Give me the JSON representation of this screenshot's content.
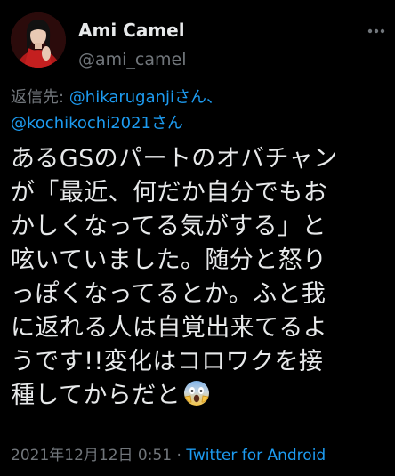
{
  "author": {
    "name": "Ami Camel",
    "handle": "@ami_camel"
  },
  "reply": {
    "prefix": "返信先: ",
    "mention1": "@hikaruganji",
    "suffix1": "さん、",
    "mention2": "@kochikochi2021",
    "suffix2": "さん"
  },
  "tweet": {
    "lines": [
      "あるGSのパートのオバチャン",
      "が「最近、何だか自分でもお",
      "かしくなってる気がする」と",
      "呟いていました。随分と怒り",
      "っぽくなってるとか。ふと我",
      "に返れる人は自覚出来てるよ",
      "うです!!変化はコロワクを接",
      "種してからだと"
    ],
    "emoji": "screaming-face-emoji"
  },
  "meta": {
    "timestamp": "2021年12月12日 0:51",
    "separator": " · ",
    "source": "Twitter for Android"
  },
  "colors": {
    "background": "#000000",
    "text": "#e7e9ea",
    "muted": "#71767b",
    "link": "#1d9bf0"
  }
}
